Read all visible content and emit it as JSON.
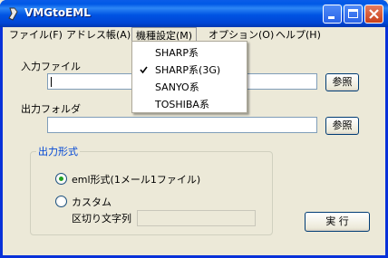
{
  "window": {
    "title": "VMGtoEML"
  },
  "menubar": {
    "items": [
      "ファイル(F)",
      "アドレス帳(A)",
      "機種設定(M)",
      "オプション(O)",
      "ヘルプ(H)"
    ]
  },
  "dropdown": {
    "items": [
      "SHARP系",
      "SHARP系(3G)",
      "SANYO系",
      "TOSHIBA系"
    ],
    "checked_index": 1
  },
  "input": {
    "label": "入力ファイル",
    "value": "",
    "browse": "参照"
  },
  "output": {
    "label": "出力フォルダ",
    "value": "",
    "browse": "参照"
  },
  "format_group": {
    "title": "出力形式",
    "option_eml": "eml形式(1メール1ファイル)",
    "option_custom": "カスタム",
    "delimiter_label": "区切り文字列",
    "delimiter_value": "",
    "selected": "eml"
  },
  "run_button": "実 行"
}
